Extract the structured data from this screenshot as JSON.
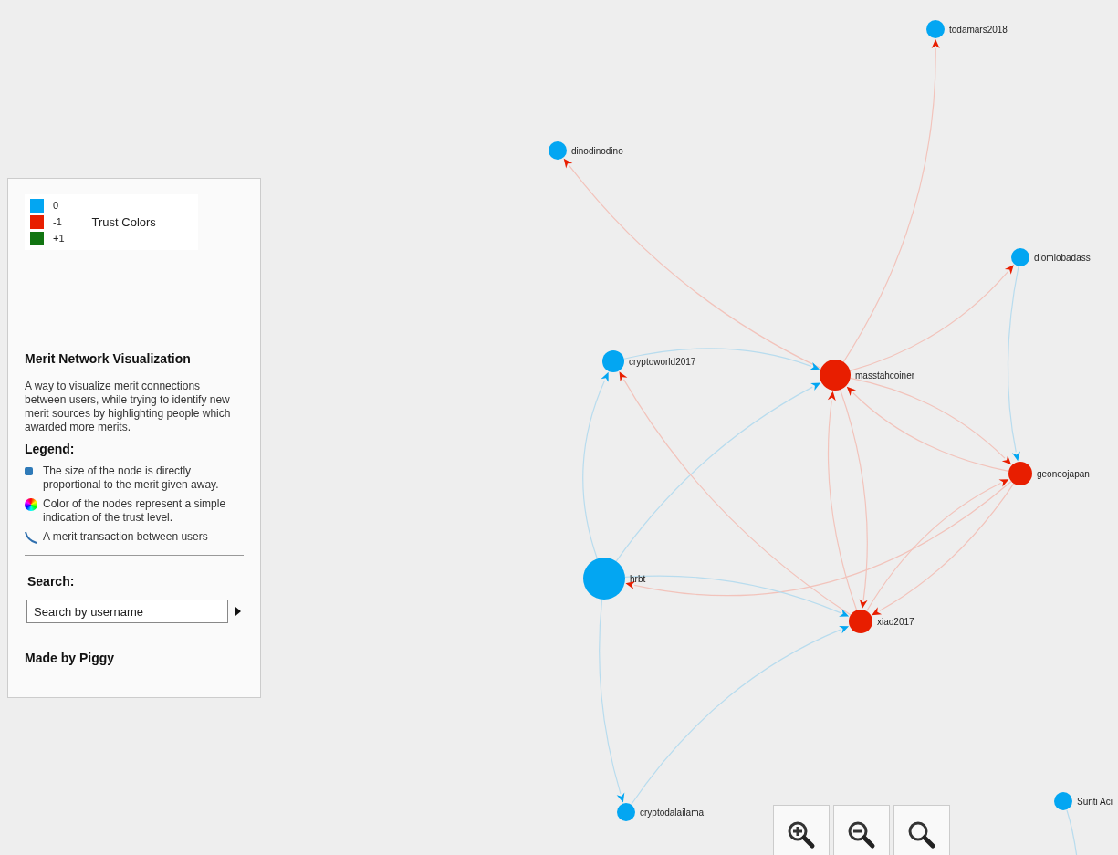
{
  "trust_colors": {
    "title": "Trust Colors",
    "items": [
      {
        "label": "0",
        "color": "#03a6f2"
      },
      {
        "label": "-1",
        "color": "#e81e00"
      },
      {
        "label": "+1",
        "color": "#127512"
      }
    ]
  },
  "panel": {
    "title": "Merit Network Visualization",
    "description": "A way to visualize merit connections between users, while trying to identify new merit sources by highlighting people which awarded more merits.",
    "legend_title": "Legend:",
    "legend": [
      {
        "kind": "size",
        "text": "The size of the node is directly proportional to the merit given away."
      },
      {
        "kind": "color",
        "text": "Color of the nodes represent a simple indication of the trust level."
      },
      {
        "kind": "edge",
        "text": "A merit transaction between users"
      }
    ],
    "search_label": "Search:",
    "search": {
      "placeholder": "Search by username"
    },
    "credit": "Made by Piggy"
  },
  "graph": {
    "nodes": [
      {
        "label": "todamars2018",
        "color": "#03a6f2"
      },
      {
        "label": "dinodinodino",
        "color": "#03a6f2"
      },
      {
        "label": "diomiobadass",
        "color": "#03a6f2"
      },
      {
        "label": "cryptoworld2017",
        "color": "#03a6f2"
      },
      {
        "label": "masstahcoiner",
        "color": "#e81e00"
      },
      {
        "label": "geoneojapan",
        "color": "#e81e00"
      },
      {
        "label": "hrbt",
        "color": "#03a6f2"
      },
      {
        "label": "xiao2017",
        "color": "#e81e00"
      },
      {
        "label": "cryptodalailama",
        "color": "#03a6f2"
      },
      {
        "label": "Sunti Aci",
        "color": "#03a6f2"
      }
    ]
  }
}
